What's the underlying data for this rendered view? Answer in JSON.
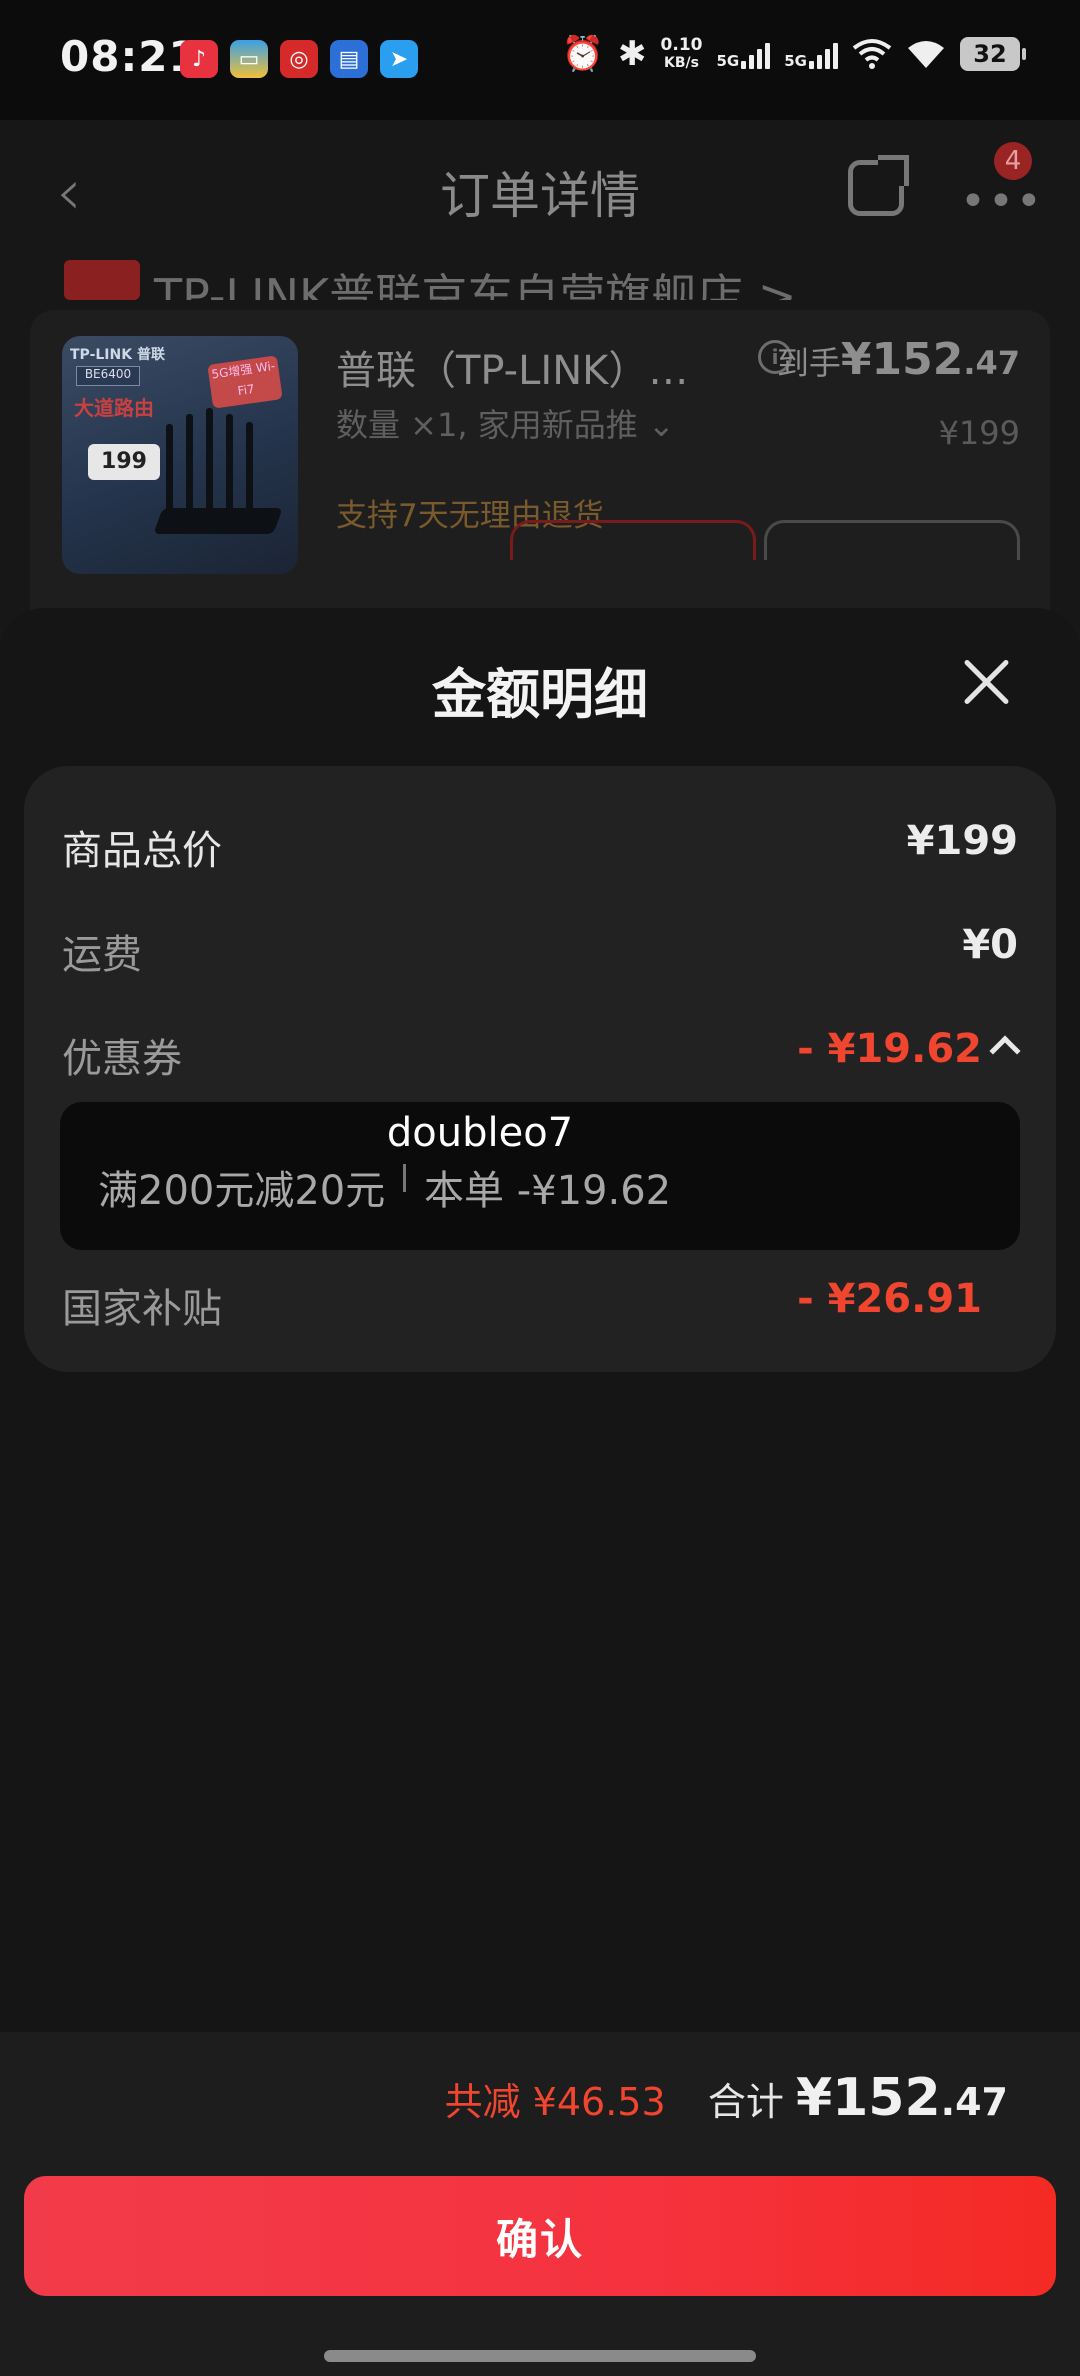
{
  "status_bar": {
    "time": "08:21",
    "net_speed_value": "0.10",
    "net_speed_unit": "KB/s",
    "signal1_label": "5G",
    "signal2_label": "5G",
    "battery": "32"
  },
  "nav": {
    "title": "订单详情",
    "badge": "4"
  },
  "background_order": {
    "store_name": "TP-LINK普联京东自营旗舰店 >",
    "product_name": "普联（TP-LINK）…",
    "spec": "数量 ×1, 家用新品推 ⌄",
    "return_policy": "支持7天无理由退货",
    "final_label": "到手",
    "final_int": "¥152",
    "final_dec": ".47",
    "original_price": "¥199",
    "image": {
      "brand": "TP-LINK 普联",
      "model": "BE6400",
      "headline": "大道路由",
      "price": "199",
      "wifi": "5G增强 Wi-Fi7"
    }
  },
  "sheet": {
    "title": "金额明细",
    "rows": {
      "goods_total": {
        "label": "商品总价",
        "value": "¥199"
      },
      "shipping": {
        "label": "运费",
        "value": "¥0"
      },
      "coupon": {
        "label": "优惠券",
        "value": "- ¥19.62"
      },
      "subsidy": {
        "label": "国家补贴",
        "value": "- ¥26.91"
      }
    },
    "coupon_detail": {
      "code": "doubleo7",
      "rule": "满200元减20元",
      "amount": "本单 -¥19.62"
    }
  },
  "footer": {
    "total_reduction": "共减 ¥46.53",
    "total_label": "合计",
    "total_int": "¥152",
    "total_dec": ".47",
    "confirm_label": "确认"
  },
  "colors": {
    "accent_red": "#f0452f",
    "button_start": "#f23b4a",
    "button_end": "#f42a24"
  }
}
